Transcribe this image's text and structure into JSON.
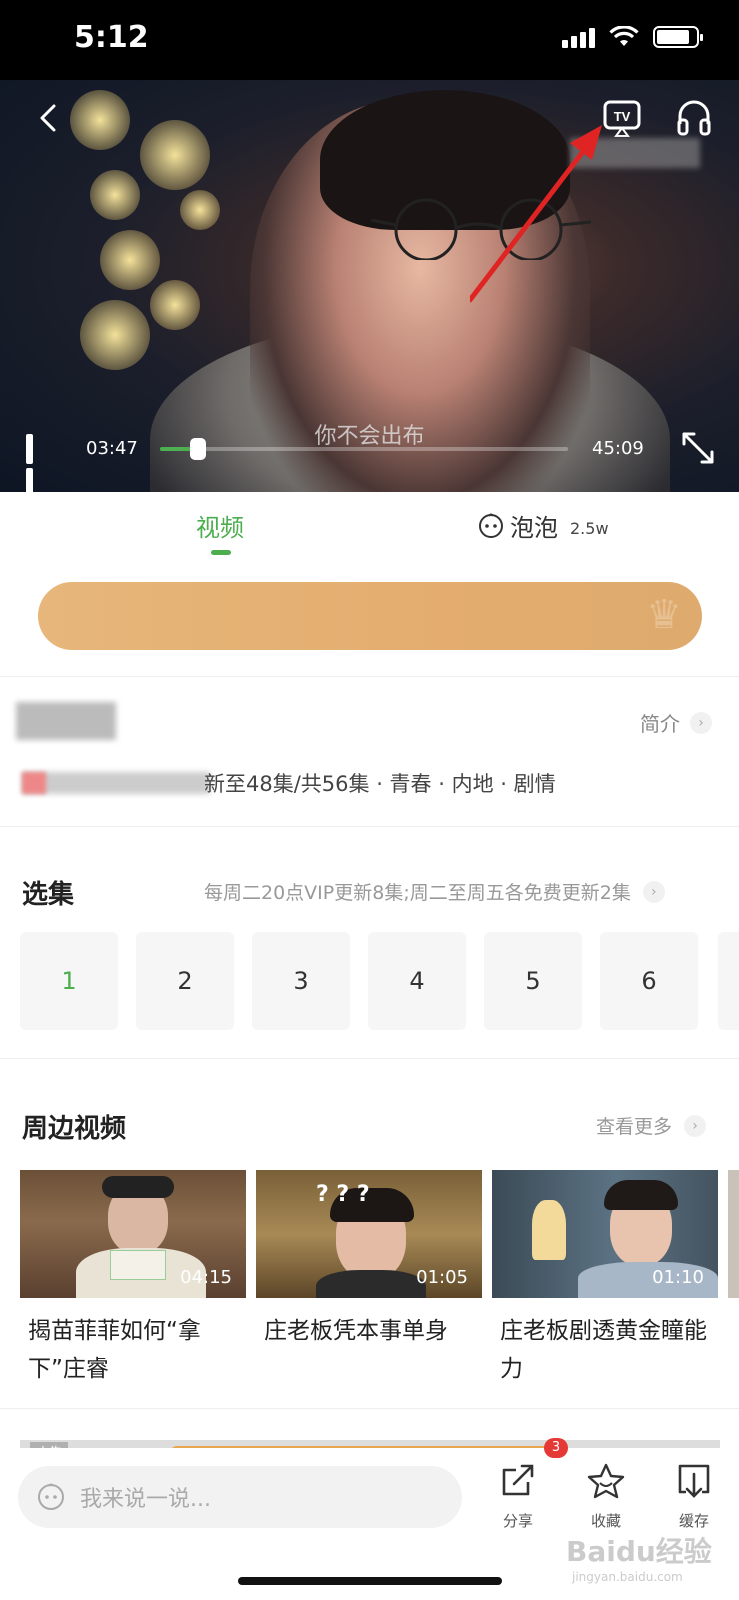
{
  "status_bar": {
    "time": "5:12"
  },
  "player": {
    "subtitle": "你不会出布",
    "current_time": "03:47",
    "total_time": "45:09",
    "progress": 0.084,
    "accent_color": "#4cae4f"
  },
  "tabs": {
    "video": "视频",
    "bubble": "泡泡",
    "bubble_count": "2.5w"
  },
  "info": {
    "intro_label": "简介",
    "meta": "新至48集/共56集 · 青春 · 内地 · 剧情"
  },
  "episodes": {
    "title": "选集",
    "schedule": "每周二20点VIP更新8集;周二至周五各免费更新2集",
    "items": [
      "1",
      "2",
      "3",
      "4",
      "5",
      "6"
    ]
  },
  "related": {
    "title": "周边视频",
    "more": "查看更多",
    "cards": [
      {
        "duration": "04:15",
        "title": "揭苗菲菲如何“拿下”庄睿"
      },
      {
        "duration": "01:05",
        "title": "庄老板凭本事单身"
      },
      {
        "duration": "01:10",
        "title": "庄老板剧透黄金瞳能力"
      }
    ]
  },
  "ad": {
    "tag": "广告",
    "badge": "3"
  },
  "bottom_bar": {
    "comment_placeholder": "我来说一说...",
    "share": "分享",
    "favorite": "收藏",
    "download": "缓存"
  },
  "watermark": {
    "brand": "Baidu经验",
    "url": "jingyan.baidu.com"
  }
}
